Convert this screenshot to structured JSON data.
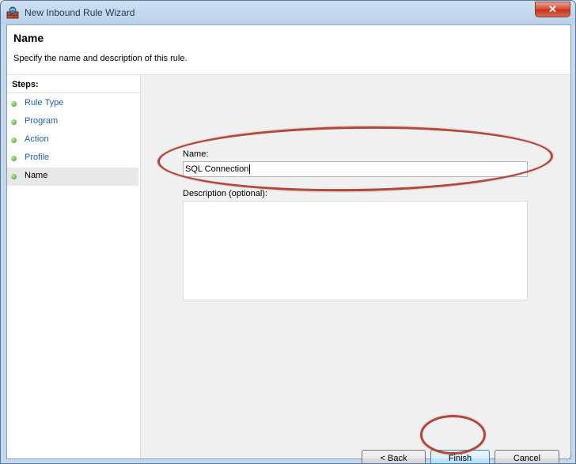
{
  "window": {
    "title": "New Inbound Rule Wizard",
    "close_label": "✕"
  },
  "header": {
    "title": "Name",
    "subtitle": "Specify the name and description of this rule."
  },
  "steps": {
    "title": "Steps:",
    "items": [
      {
        "label": "Rule Type"
      },
      {
        "label": "Program"
      },
      {
        "label": "Action"
      },
      {
        "label": "Profile"
      },
      {
        "label": "Name"
      }
    ]
  },
  "form": {
    "name_label": "Name:",
    "name_value": "SQL Connection",
    "description_label": "Description (optional):",
    "description_value": ""
  },
  "buttons": {
    "back": "< Back",
    "finish": "Finish",
    "cancel": "Cancel"
  },
  "colors": {
    "annotation": "#b3473a",
    "step_link": "#1e5fa8",
    "step_dot": "#3c9a22"
  }
}
